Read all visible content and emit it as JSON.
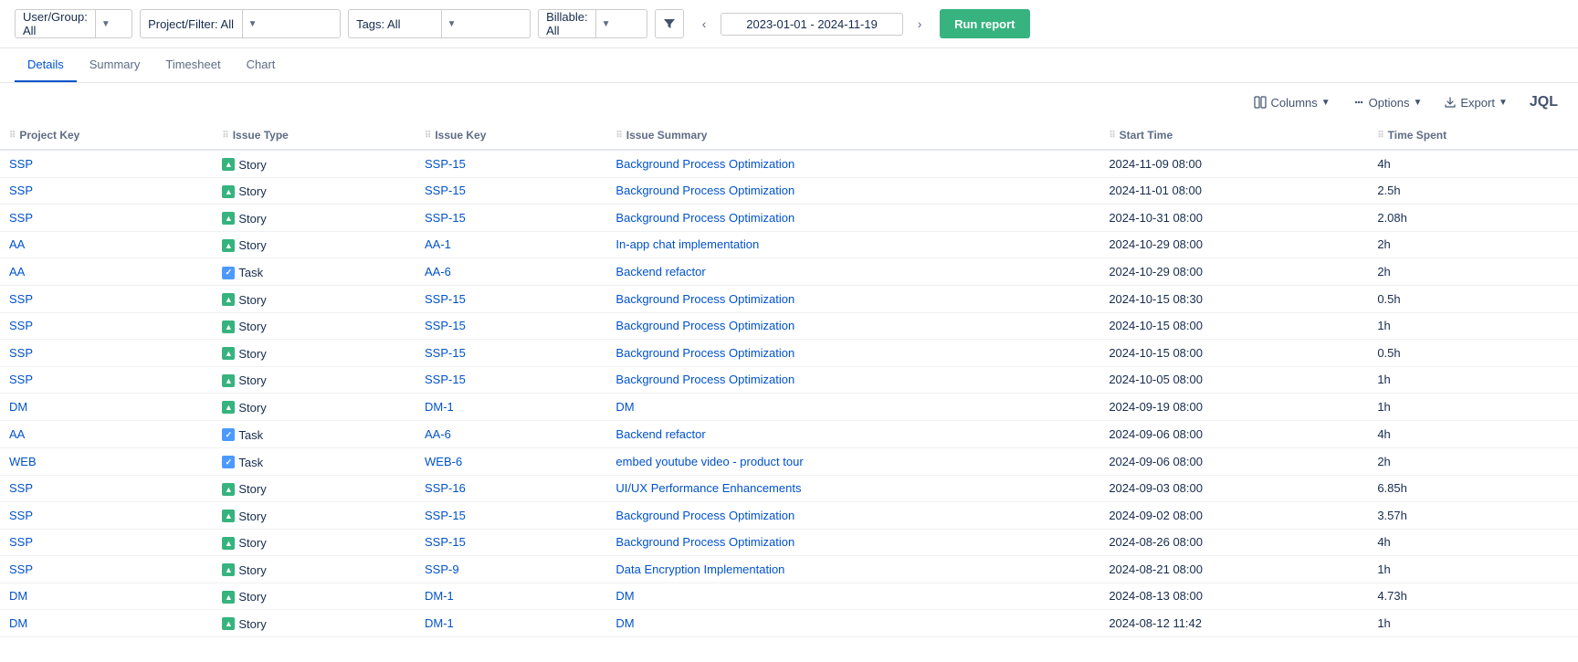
{
  "filterBar": {
    "userGroup": {
      "label": "User/Group: All",
      "options": [
        "All"
      ]
    },
    "projectFilter": {
      "label": "Project/Filter: All",
      "options": [
        "All"
      ]
    },
    "tags": {
      "label": "Tags: All",
      "options": [
        "All"
      ]
    },
    "billable": {
      "label": "Billable: All",
      "options": [
        "All"
      ]
    },
    "dateRange": "2023-01-01 - 2024-11-19",
    "runButton": "Run report"
  },
  "tabs": [
    {
      "id": "details",
      "label": "Details",
      "active": true
    },
    {
      "id": "summary",
      "label": "Summary",
      "active": false
    },
    {
      "id": "timesheet",
      "label": "Timesheet",
      "active": false
    },
    {
      "id": "chart",
      "label": "Chart",
      "active": false
    }
  ],
  "toolbar": {
    "columns": "Columns",
    "options": "Options",
    "export": "Export",
    "jql": "JQL"
  },
  "table": {
    "columns": [
      {
        "id": "project-key",
        "label": "Project Key"
      },
      {
        "id": "issue-type",
        "label": "Issue Type"
      },
      {
        "id": "issue-key",
        "label": "Issue Key"
      },
      {
        "id": "issue-summary",
        "label": "Issue Summary"
      },
      {
        "id": "start-time",
        "label": "Start Time"
      },
      {
        "id": "time-spent",
        "label": "Time Spent"
      }
    ],
    "rows": [
      {
        "projectKey": "SSP",
        "issueType": "Story",
        "issueTypeKind": "story",
        "issueKey": "SSP-15",
        "issueSummary": "Background Process Optimization",
        "startTime": "2024-11-09 08:00",
        "timeSpent": "4h"
      },
      {
        "projectKey": "SSP",
        "issueType": "Story",
        "issueTypeKind": "story",
        "issueKey": "SSP-15",
        "issueSummary": "Background Process Optimization",
        "startTime": "2024-11-01 08:00",
        "timeSpent": "2.5h"
      },
      {
        "projectKey": "SSP",
        "issueType": "Story",
        "issueTypeKind": "story",
        "issueKey": "SSP-15",
        "issueSummary": "Background Process Optimization",
        "startTime": "2024-10-31 08:00",
        "timeSpent": "2.08h"
      },
      {
        "projectKey": "AA",
        "issueType": "Story",
        "issueTypeKind": "story",
        "issueKey": "AA-1",
        "issueSummary": "In-app chat implementation",
        "startTime": "2024-10-29 08:00",
        "timeSpent": "2h"
      },
      {
        "projectKey": "AA",
        "issueType": "Task",
        "issueTypeKind": "task",
        "issueKey": "AA-6",
        "issueSummary": "Backend refactor",
        "startTime": "2024-10-29 08:00",
        "timeSpent": "2h"
      },
      {
        "projectKey": "SSP",
        "issueType": "Story",
        "issueTypeKind": "story",
        "issueKey": "SSP-15",
        "issueSummary": "Background Process Optimization",
        "startTime": "2024-10-15 08:30",
        "timeSpent": "0.5h"
      },
      {
        "projectKey": "SSP",
        "issueType": "Story",
        "issueTypeKind": "story",
        "issueKey": "SSP-15",
        "issueSummary": "Background Process Optimization",
        "startTime": "2024-10-15 08:00",
        "timeSpent": "1h"
      },
      {
        "projectKey": "SSP",
        "issueType": "Story",
        "issueTypeKind": "story",
        "issueKey": "SSP-15",
        "issueSummary": "Background Process Optimization",
        "startTime": "2024-10-15 08:00",
        "timeSpent": "0.5h"
      },
      {
        "projectKey": "SSP",
        "issueType": "Story",
        "issueTypeKind": "story",
        "issueKey": "SSP-15",
        "issueSummary": "Background Process Optimization",
        "startTime": "2024-10-05 08:00",
        "timeSpent": "1h"
      },
      {
        "projectKey": "DM",
        "issueType": "Story",
        "issueTypeKind": "story",
        "issueKey": "DM-1",
        "issueSummary": "DM",
        "startTime": "2024-09-19 08:00",
        "timeSpent": "1h"
      },
      {
        "projectKey": "AA",
        "issueType": "Task",
        "issueTypeKind": "task",
        "issueKey": "AA-6",
        "issueSummary": "Backend refactor",
        "startTime": "2024-09-06 08:00",
        "timeSpent": "4h"
      },
      {
        "projectKey": "WEB",
        "issueType": "Task",
        "issueTypeKind": "task",
        "issueKey": "WEB-6",
        "issueSummary": "embed youtube video - product tour",
        "startTime": "2024-09-06 08:00",
        "timeSpent": "2h"
      },
      {
        "projectKey": "SSP",
        "issueType": "Story",
        "issueTypeKind": "story",
        "issueKey": "SSP-16",
        "issueSummary": "UI/UX Performance Enhancements",
        "startTime": "2024-09-03 08:00",
        "timeSpent": "6.85h"
      },
      {
        "projectKey": "SSP",
        "issueType": "Story",
        "issueTypeKind": "story",
        "issueKey": "SSP-15",
        "issueSummary": "Background Process Optimization",
        "startTime": "2024-09-02 08:00",
        "timeSpent": "3.57h"
      },
      {
        "projectKey": "SSP",
        "issueType": "Story",
        "issueTypeKind": "story",
        "issueKey": "SSP-15",
        "issueSummary": "Background Process Optimization",
        "startTime": "2024-08-26 08:00",
        "timeSpent": "4h"
      },
      {
        "projectKey": "SSP",
        "issueType": "Story",
        "issueTypeKind": "story",
        "issueKey": "SSP-9",
        "issueSummary": "Data Encryption Implementation",
        "startTime": "2024-08-21 08:00",
        "timeSpent": "1h"
      },
      {
        "projectKey": "DM",
        "issueType": "Story",
        "issueTypeKind": "story",
        "issueKey": "DM-1",
        "issueSummary": "DM",
        "startTime": "2024-08-13 08:00",
        "timeSpent": "4.73h"
      },
      {
        "projectKey": "DM",
        "issueType": "Story",
        "issueTypeKind": "story",
        "issueKey": "DM-1",
        "issueSummary": "DM",
        "startTime": "2024-08-12 11:42",
        "timeSpent": "1h"
      }
    ]
  }
}
